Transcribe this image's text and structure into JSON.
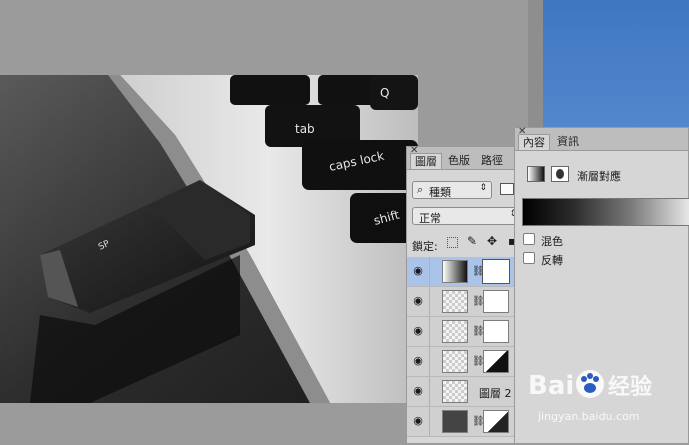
{
  "layers_panel": {
    "tabs": [
      "圖層",
      "色版",
      "路徑"
    ],
    "filter_select": "種類",
    "blend_mode": "正常",
    "lock_label": "鎖定:",
    "rows": [
      {
        "name": "",
        "selected": true
      },
      {
        "name": "",
        "selected": false
      },
      {
        "name": "",
        "selected": false
      },
      {
        "name": "",
        "selected": false
      },
      {
        "name": "圖層 2",
        "selected": false
      },
      {
        "name": "",
        "selected": false
      }
    ]
  },
  "properties_panel": {
    "tabs": [
      "內容",
      "資訊"
    ],
    "title": "漸層對應",
    "dither_label": "混色",
    "reverse_label": "反轉"
  },
  "photo": {
    "key_tab": "tab",
    "key_caps": "caps lock",
    "key_shift": "shift",
    "key_q": "Q",
    "usb_brand": "SP"
  },
  "watermark": {
    "logo": "Bai 经验",
    "url": "jingyan.baidu.com"
  },
  "colors": {
    "panel_bg": "#d6d6d6",
    "selection": "#a9c4e8",
    "canvas_gray": "#9b9b9b"
  }
}
